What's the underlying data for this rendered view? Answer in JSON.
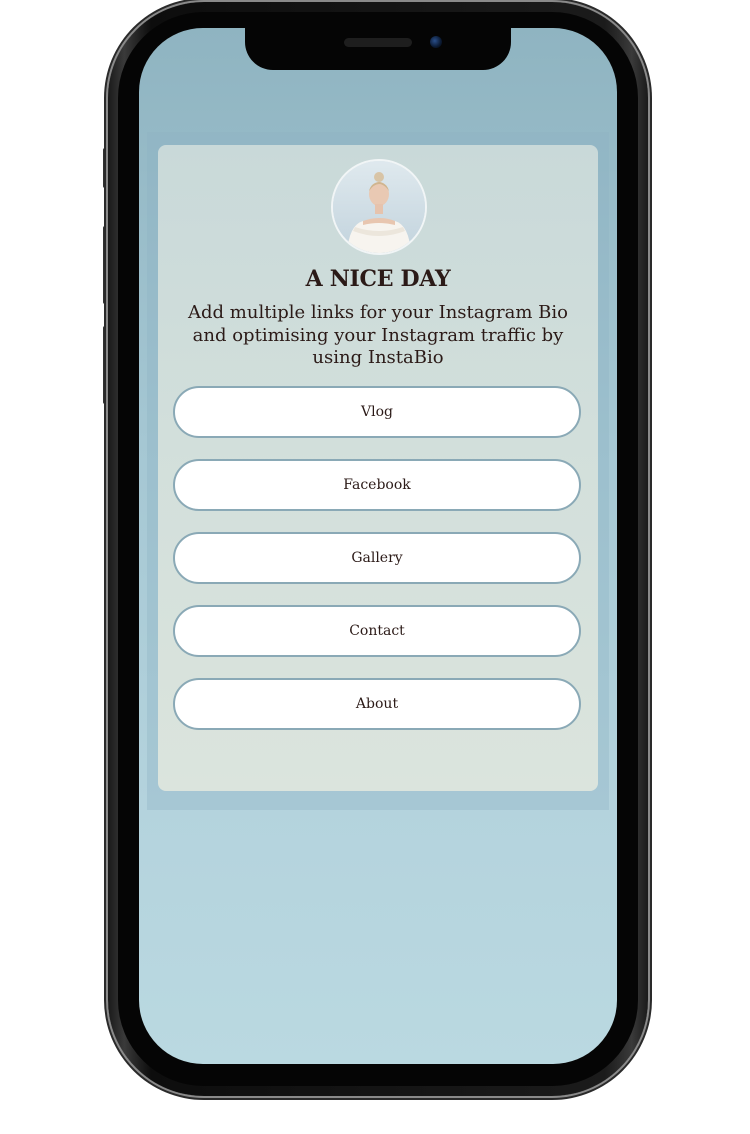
{
  "profile": {
    "title": "A NICE DAY",
    "description": "Add multiple links for your Instagram Bio and optimising your Instagram traffic by using InstaBio"
  },
  "links": [
    {
      "label": "Vlog"
    },
    {
      "label": "Facebook"
    },
    {
      "label": "Gallery"
    },
    {
      "label": "Contact"
    },
    {
      "label": "About"
    }
  ],
  "colors": {
    "screen_top": "#8fb4c1",
    "screen_bottom": "#bad9e1",
    "card": "#d2dfdb",
    "button_bg": "#ffffff",
    "button_border": "#8aa9b6",
    "text": "#2b1a17"
  }
}
